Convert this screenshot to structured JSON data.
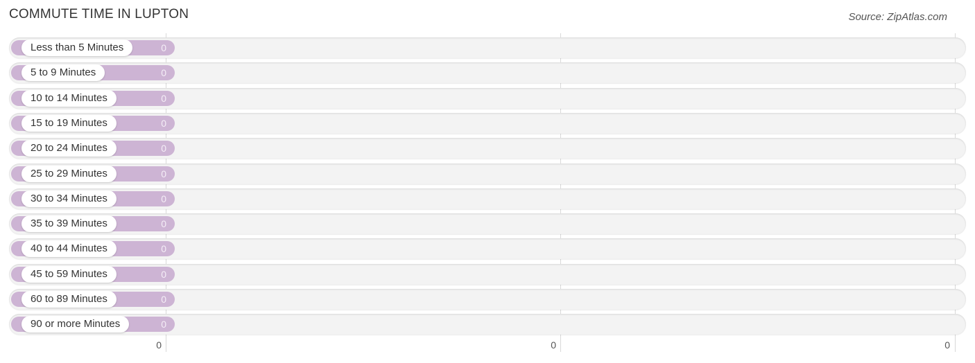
{
  "header": {
    "title": "COMMUTE TIME IN LUPTON",
    "source": "Source: ZipAtlas.com"
  },
  "colors": {
    "bar": "#cdb4d4",
    "track": "#f3f3f3",
    "value_text": "#f5eef7"
  },
  "chart_data": {
    "type": "bar",
    "orientation": "horizontal",
    "title": "COMMUTE TIME IN LUPTON",
    "xlabel": "",
    "ylabel": "",
    "categories": [
      "Less than 5 Minutes",
      "5 to 9 Minutes",
      "10 to 14 Minutes",
      "15 to 19 Minutes",
      "20 to 24 Minutes",
      "25 to 29 Minutes",
      "30 to 34 Minutes",
      "35 to 39 Minutes",
      "40 to 44 Minutes",
      "45 to 59 Minutes",
      "60 to 89 Minutes",
      "90 or more Minutes"
    ],
    "values": [
      0,
      0,
      0,
      0,
      0,
      0,
      0,
      0,
      0,
      0,
      0,
      0
    ],
    "value_labels": [
      "0",
      "0",
      "0",
      "0",
      "0",
      "0",
      "0",
      "0",
      "0",
      "0",
      "0",
      "0"
    ],
    "x_tick_labels": [
      "0",
      "0",
      "0"
    ],
    "grid": true,
    "legend": "none"
  }
}
